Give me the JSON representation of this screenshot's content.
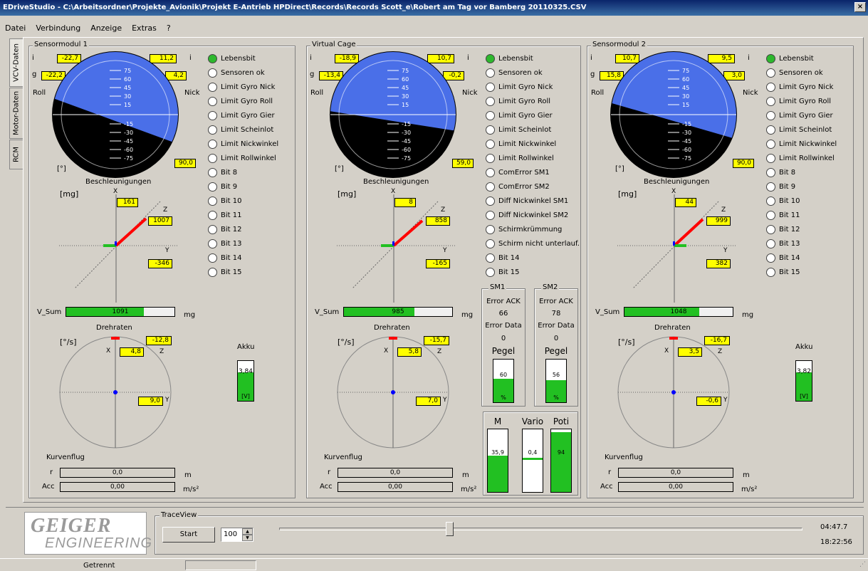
{
  "window": {
    "title": "EDriveStudio - C:\\Arbeitsordner\\Projekte_Avionik\\Projekt E-Antrieb HPDirect\\Records\\Records Scott_e\\Robert am Tag vor Bamberg 20110325.CSV",
    "close": "×"
  },
  "menu": [
    "Datei",
    "Verbindung",
    "Anzeige",
    "Extras",
    "?"
  ],
  "tabs": [
    "VCV-Daten",
    "Motor-Daten",
    "RCM"
  ],
  "labels": {
    "i": "i",
    "g": "g",
    "roll": "Roll",
    "nick": "Nick",
    "deg": "[°]",
    "beschl": "Beschleunigungen",
    "mg_unit": "[mg]",
    "x": "X",
    "y": "Y",
    "z": "Z",
    "vsum": "V_Sum",
    "mg": "mg",
    "drehraten": "Drehraten",
    "degs": "[°/s]",
    "kurvenflug": "Kurvenflug",
    "r": "r",
    "acc": "Acc",
    "m": "m",
    "ms2": "m/s²",
    "akku": "Akku",
    "volt": "[V]",
    "pct": "%"
  },
  "ticks_up": [
    "75",
    "60",
    "45",
    "30",
    "15"
  ],
  "ticks_down": [
    "-15",
    "-30",
    "-45",
    "-60",
    "-75"
  ],
  "panels": [
    {
      "title": "Sensormodul 1",
      "i_left": "-22,7",
      "i_right": "11,2",
      "g_left": "-22,2",
      "g_right": "4,2",
      "angle": "90,0",
      "bx": "161",
      "bz": "1007",
      "by": "-346",
      "vsum": "1091",
      "vsum_frac": 0.72,
      "dr_top": "-12,8",
      "dr_x": "4,8",
      "dr_y": "9,0",
      "r": "0,0",
      "acc": "0,00",
      "akku": "3,84",
      "akku_frac": 0.72,
      "leds": [
        {
          "label": "Lebensbit",
          "on": true
        },
        {
          "label": "Sensoren ok",
          "on": false
        },
        {
          "label": "Limit Gyro Nick",
          "on": false
        },
        {
          "label": "Limit Gyro Roll",
          "on": false
        },
        {
          "label": "Limit Gyro Gier",
          "on": false
        },
        {
          "label": "Limit Scheinlot",
          "on": false
        },
        {
          "label": "Limit Nickwinkel",
          "on": false
        },
        {
          "label": "Limit Rollwinkel",
          "on": false
        },
        {
          "label": "Bit 8",
          "on": false
        },
        {
          "label": "Bit 9",
          "on": false
        },
        {
          "label": "Bit 10",
          "on": false
        },
        {
          "label": "Bit 11",
          "on": false
        },
        {
          "label": "Bit 12",
          "on": false
        },
        {
          "label": "Bit 13",
          "on": false
        },
        {
          "label": "Bit 14",
          "on": false
        },
        {
          "label": "Bit 15",
          "on": false
        }
      ]
    },
    {
      "title": "Virtual Cage",
      "i_left": "-18,9",
      "i_right": "10,7",
      "g_left": "-13,4",
      "g_right": "-0,2",
      "angle": "59,0",
      "bx": "8",
      "bz": "858",
      "by": "-165",
      "vsum": "985",
      "vsum_frac": 0.65,
      "dr_top": "-15,7",
      "dr_x": "5,8",
      "dr_y": "7,0",
      "r": "0,0",
      "acc": "0,00",
      "leds": [
        {
          "label": "Lebensbit",
          "on": true
        },
        {
          "label": "Sensoren ok",
          "on": false
        },
        {
          "label": "Limit Gyro Nick",
          "on": false
        },
        {
          "label": "Limit Gyro Roll",
          "on": false
        },
        {
          "label": "Limit Gyro Gier",
          "on": false
        },
        {
          "label": "Limit Scheinlot",
          "on": false
        },
        {
          "label": "Limit Nickwinkel",
          "on": false
        },
        {
          "label": "Limit Rollwinkel",
          "on": false
        },
        {
          "label": "ComError SM1",
          "on": false
        },
        {
          "label": "ComError SM2",
          "on": false
        },
        {
          "label": "Diff Nickwinkel SM1",
          "on": false
        },
        {
          "label": "Diff Nickwinkel SM2",
          "on": false
        },
        {
          "label": "Schirmkrümmung",
          "on": false
        },
        {
          "label": "Schirm nicht unterlauf.",
          "on": false
        },
        {
          "label": "Bit 14",
          "on": false
        },
        {
          "label": "Bit 15",
          "on": false
        }
      ]
    },
    {
      "title": "Sensormodul 2",
      "i_left": "10,7",
      "i_right": "9,5",
      "g_left": "15,8",
      "g_right": "3,0",
      "angle": "90,0",
      "bx": "44",
      "bz": "999",
      "by": "382",
      "vsum": "1048",
      "vsum_frac": 0.69,
      "dr_top": "-16,7",
      "dr_x": "3,5",
      "dr_y": "-0,6",
      "r": "0,0",
      "acc": "0,00",
      "akku": "3,82",
      "akku_frac": 0.72,
      "leds": [
        {
          "label": "Lebensbit",
          "on": true
        },
        {
          "label": "Sensoren ok",
          "on": false
        },
        {
          "label": "Limit Gyro Nick",
          "on": false
        },
        {
          "label": "Limit Gyro Roll",
          "on": false
        },
        {
          "label": "Limit Gyro Gier",
          "on": false
        },
        {
          "label": "Limit Scheinlot",
          "on": false
        },
        {
          "label": "Limit Nickwinkel",
          "on": false
        },
        {
          "label": "Limit Rollwinkel",
          "on": false
        },
        {
          "label": "Bit 8",
          "on": false
        },
        {
          "label": "Bit 9",
          "on": false
        },
        {
          "label": "Bit 10",
          "on": false
        },
        {
          "label": "Bit 11",
          "on": false
        },
        {
          "label": "Bit 12",
          "on": false
        },
        {
          "label": "Bit 13",
          "on": false
        },
        {
          "label": "Bit 14",
          "on": false
        },
        {
          "label": "Bit 15",
          "on": false
        }
      ]
    }
  ],
  "sm": [
    {
      "title": "SM1",
      "err_ack": "Error ACK",
      "ack": "66",
      "err_data": "Error Data",
      "data": "0",
      "pegel": "Pegel",
      "level": "60",
      "level_frac": 0.55
    },
    {
      "title": "SM2",
      "err_ack": "Error ACK",
      "ack": "78",
      "err_data": "Error Data",
      "data": "0",
      "pegel": "Pegel",
      "level": "56",
      "level_frac": 0.52
    }
  ],
  "motor": [
    {
      "label": "M",
      "value": "35,9",
      "frac": 0.58
    },
    {
      "label": "Vario",
      "value": "0,4",
      "frac": 0
    },
    {
      "label": "Poti",
      "value": "94",
      "frac": 0.96
    }
  ],
  "logo": {
    "line1": "GEIGER",
    "line2": "ENGINEERING"
  },
  "trace": {
    "title": "TraceView",
    "start": "Start",
    "speed": "100",
    "slider_frac": 0.325,
    "time1": "04:47.7",
    "time2": "18:22:56"
  },
  "status": {
    "text": "Getrennt"
  },
  "colors": {
    "sky": "#4a6fe8",
    "ground": "#000000",
    "indicator": "#ffff00",
    "fill": "#22c022",
    "arrow": "#ff0000"
  }
}
